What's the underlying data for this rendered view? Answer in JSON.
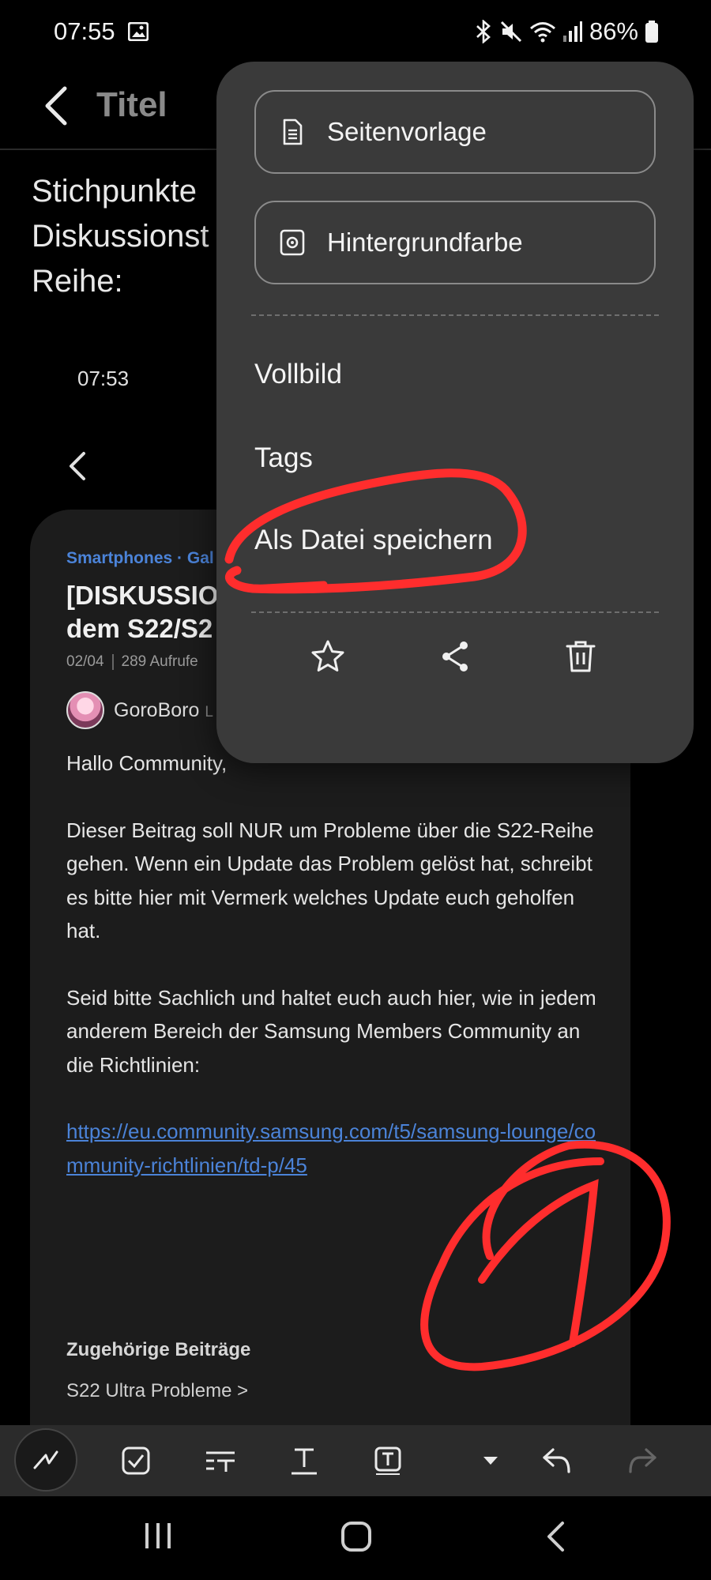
{
  "status_bar": {
    "time": "07:55",
    "battery": "86%"
  },
  "header": {
    "title": "Titel"
  },
  "note": {
    "body_text": "Stichpunkte\nDiskussionst\nReihe:"
  },
  "embedded_screenshot": {
    "time": "07:53",
    "breadcrumb": "Smartphones · Gal",
    "title": "[DISKUSSIO\ndem S22/S2",
    "date": "02/04",
    "views": "289 Aufrufe",
    "author": "GoroBoro",
    "author_suffix": "L",
    "paragraphs": [
      "Hallo Community,",
      "Dieser Beitrag soll NUR um Probleme über die S22-Reihe gehen. Wenn ein Update das Problem gelöst hat, schreibt es bitte hier mit Vermerk welches Update euch geholfen hat.",
      "Seid bitte Sachlich und haltet euch auch hier, wie in jedem anderem Bereich der Samsung Members Community an die Richtlinien:"
    ],
    "link": "https://eu.community.samsung.com/t5/samsung-lounge/community-richtlinien/td-p/45",
    "related_heading": "Zugehörige Beiträge",
    "related_item": "S22 Ultra Probleme >"
  },
  "menu": {
    "page_template": "Seitenvorlage",
    "background_color": "Hintergrundfarbe",
    "fullscreen": "Vollbild",
    "tags": "Tags",
    "save_as_file": "Als Datei speichern",
    "icons": [
      "star-icon",
      "share-icon",
      "trash-icon"
    ]
  },
  "toolbar": {
    "icons": [
      "pen-icon",
      "checkbox-icon",
      "text-style-icon",
      "text-format-icon",
      "textbox-icon",
      "dropdown-icon",
      "undo-icon",
      "redo-icon"
    ]
  },
  "colors": {
    "accent_link": "#4b83d8",
    "annotation_red": "#ff2d2d",
    "menu_bg": "#3a3a3a"
  }
}
